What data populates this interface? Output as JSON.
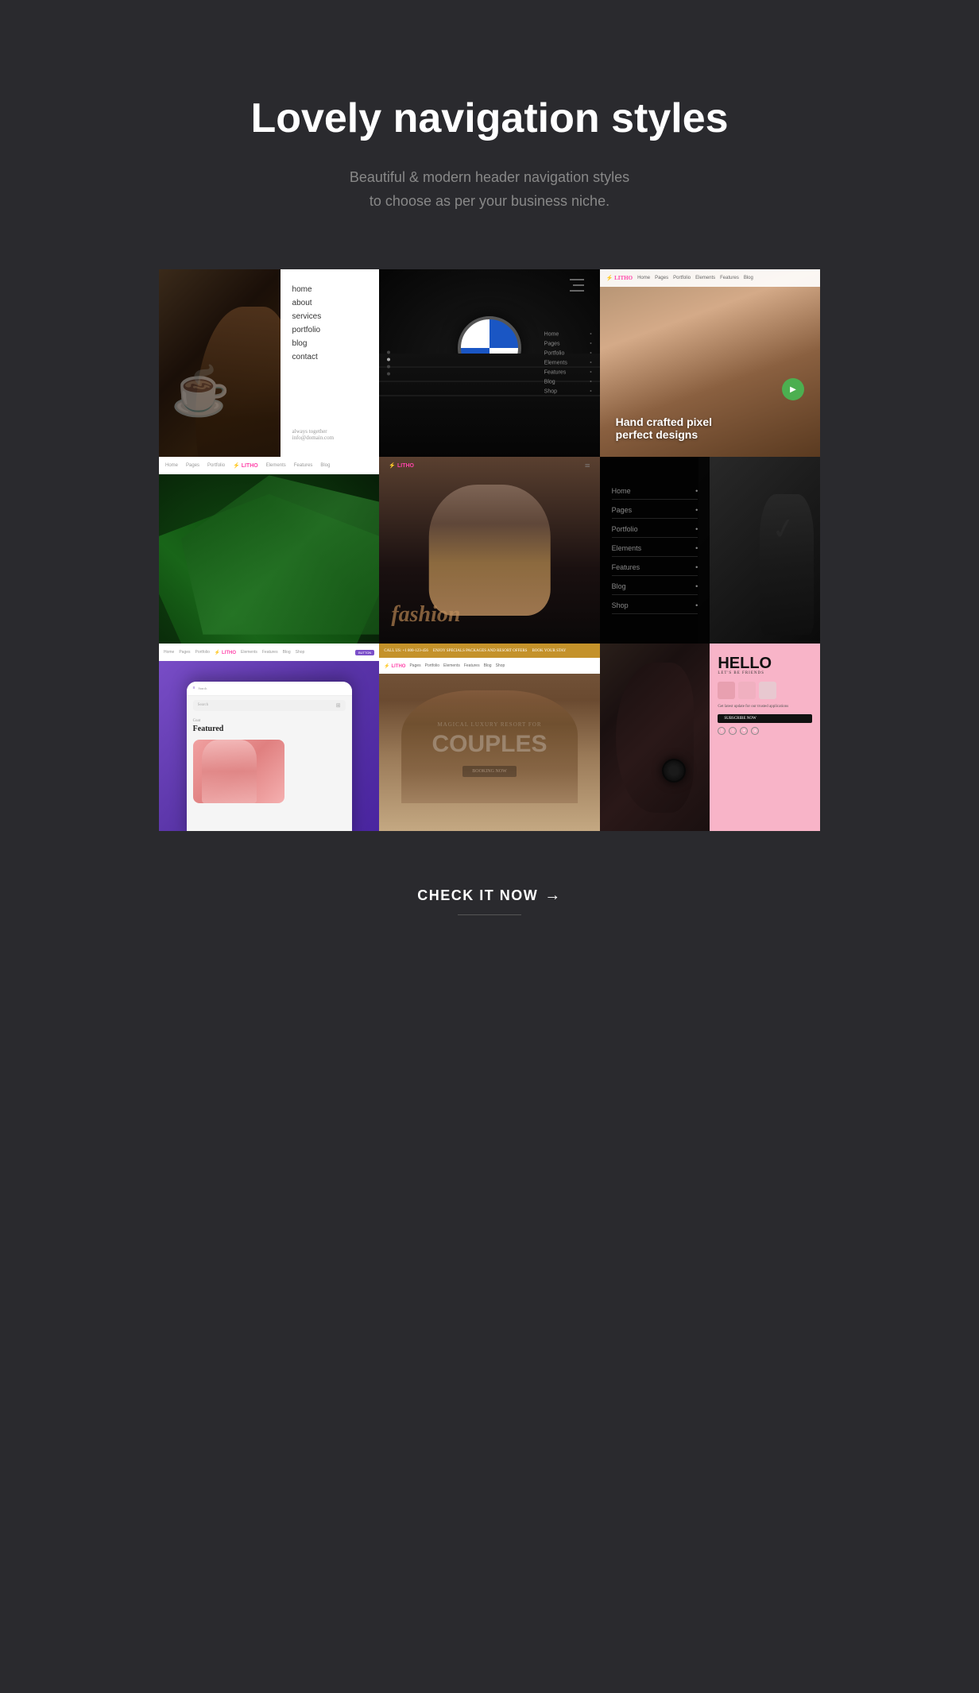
{
  "hero": {
    "title": "Lovely navigation styles",
    "subtitle_line1": "Beautiful & modern header navigation styles",
    "subtitle_line2": "to choose as per your business niche."
  },
  "grid": {
    "rows": [
      {
        "cells": [
          {
            "id": "coffee-menu",
            "type": "coffee-menu",
            "menu_items": [
              "home",
              "about",
              "services",
              "portfolio",
              "blog",
              "contact"
            ],
            "footer": "always together\ninfo@domain.com"
          },
          {
            "id": "bmw",
            "type": "bmw-dark",
            "menu_items": [
              "Home",
              "Pages",
              "Portfolio",
              "Elements",
              "Features",
              "Blog",
              "Shop"
            ]
          },
          {
            "id": "litho-people",
            "type": "litho-people",
            "nav_items": [
              "Home",
              "Pages",
              "Portfolio",
              "Elements",
              "Features",
              "Blog"
            ],
            "logo": "LITHO",
            "overlay_text": "Hand crafted pixel\nperfect designs"
          }
        ]
      },
      {
        "cells": [
          {
            "id": "palm",
            "type": "palm-leaf",
            "nav_items": [
              "Home",
              "Pages",
              "Portfolio",
              "LITHO",
              "Elements",
              "Features",
              "Blog"
            ],
            "logo": "LITHO"
          },
          {
            "id": "fashion",
            "type": "fashion-model",
            "logo": "LITHO",
            "text": "fashion"
          },
          {
            "id": "nike-menu",
            "type": "nike-menu",
            "menu_items": [
              "Home",
              "Pages",
              "Portfolio",
              "Elements",
              "Features",
              "Blog",
              "Shop"
            ]
          }
        ]
      },
      {
        "cells": [
          {
            "id": "mobile-app",
            "type": "mobile-app",
            "nav_items": [
              "Home",
              "Pages",
              "Portfolio",
              "Elements",
              "Features",
              "Blog",
              "Shop"
            ],
            "search_placeholder": "Search",
            "coat_label": "Coat",
            "featured_label": "Featured"
          },
          {
            "id": "couples",
            "type": "couples-resort",
            "top_bar_text": "CALL US: +1 800-123-456",
            "middle_text": "ENJOY SPECIALS PACKAGES AND RESORT OFFERS",
            "book_text": "BOOK YOUR STAY",
            "logo": "LITHO",
            "nav_items": [
              "Pages",
              "Portfolio",
              "Elements",
              "Features",
              "Blog",
              "Shop"
            ],
            "small_text": "MAGICAL LUXURY RESORT FOR",
            "big_text": "COUPLES",
            "book_btn": "BOOKING NOW"
          },
          {
            "id": "split",
            "type": "split-card",
            "hello_title": "HELLO",
            "hello_sub": "LET'S BE FRIENDS",
            "app_desc": "Get latest update for our trusted applications",
            "download_btn": "SUBSCRIBE NOW"
          }
        ]
      }
    ]
  },
  "cta": {
    "button_text": "CHECK IT NOW",
    "arrow": "→"
  }
}
